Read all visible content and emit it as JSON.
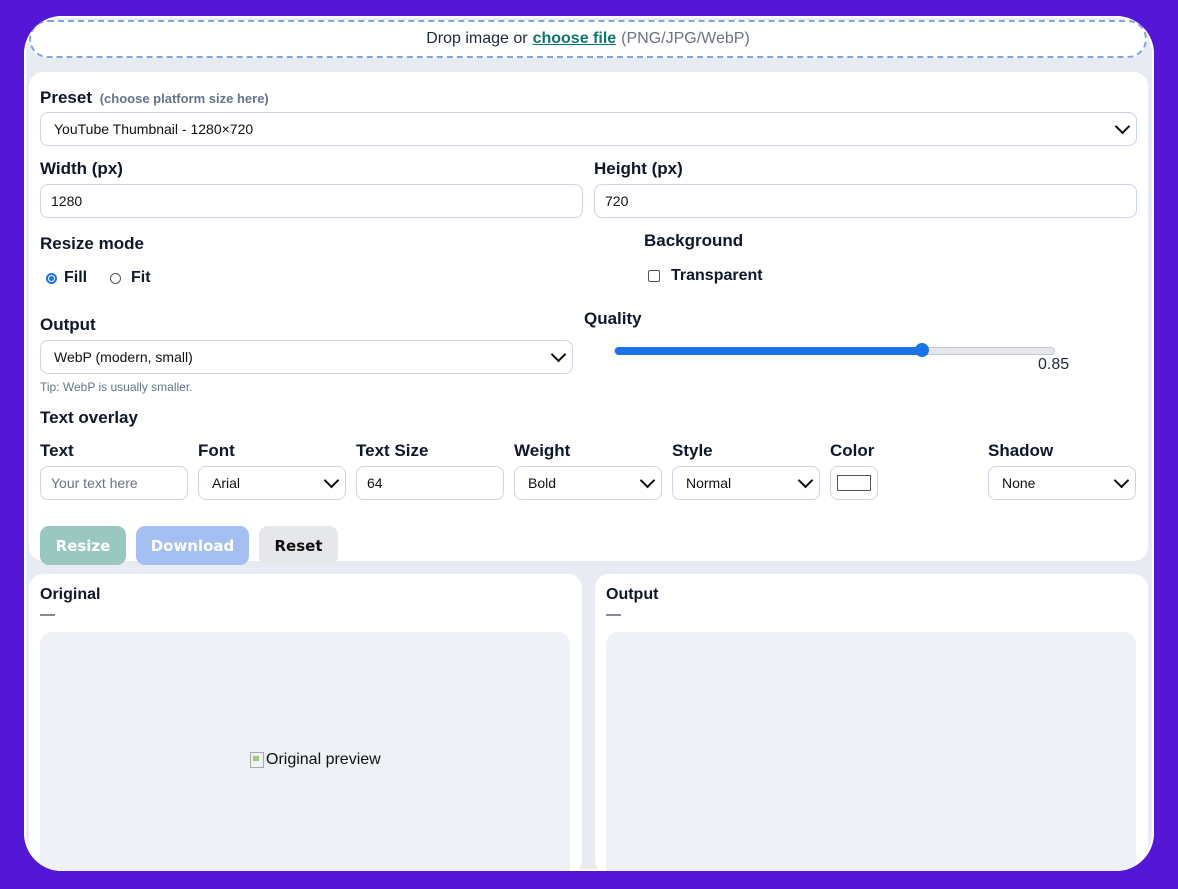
{
  "dropzone": {
    "prefix": "Drop image or",
    "link": "choose file",
    "formats": "(PNG/JPG/WebP)"
  },
  "preset": {
    "label": "Preset",
    "hint": "(choose platform size here)",
    "value": "YouTube Thumbnail - 1280×720"
  },
  "width": {
    "label": "Width (px)",
    "value": "1280"
  },
  "height": {
    "label": "Height (px)",
    "value": "720"
  },
  "resize_mode": {
    "label": "Resize mode",
    "options": [
      "Fill",
      "Fit"
    ],
    "selected": "Fill"
  },
  "background": {
    "label": "Background",
    "transparent_label": "Transparent",
    "transparent_checked": false
  },
  "output": {
    "label": "Output",
    "value": "WebP (modern, small)",
    "tip": "Tip: WebP is usually smaller."
  },
  "quality": {
    "label": "Quality",
    "value": 0.85,
    "display": "0.85",
    "min": 0,
    "max": 1
  },
  "text_overlay": {
    "title": "Text overlay",
    "text": {
      "label": "Text",
      "placeholder": "Your text here"
    },
    "font": {
      "label": "Font",
      "value": "Arial"
    },
    "size": {
      "label": "Text Size",
      "value": "64"
    },
    "weight": {
      "label": "Weight",
      "value": "Bold"
    },
    "style": {
      "label": "Style",
      "value": "Normal"
    },
    "color": {
      "label": "Color",
      "value": "#ffffff"
    },
    "shadow": {
      "label": "Shadow",
      "value": "None"
    }
  },
  "buttons": {
    "resize": "Resize",
    "download": "Download",
    "reset": "Reset"
  },
  "colors": {
    "page_bg": "#5417d6",
    "accent": "#1a73e8",
    "resize_btn": "#9ac7c0",
    "download_btn": "#a5bff3",
    "reset_btn": "#e5e7eb",
    "link": "#0f766e"
  },
  "original": {
    "title": "Original",
    "meta": "—",
    "alt": "Original preview"
  },
  "result": {
    "title": "Output",
    "meta": "—"
  }
}
